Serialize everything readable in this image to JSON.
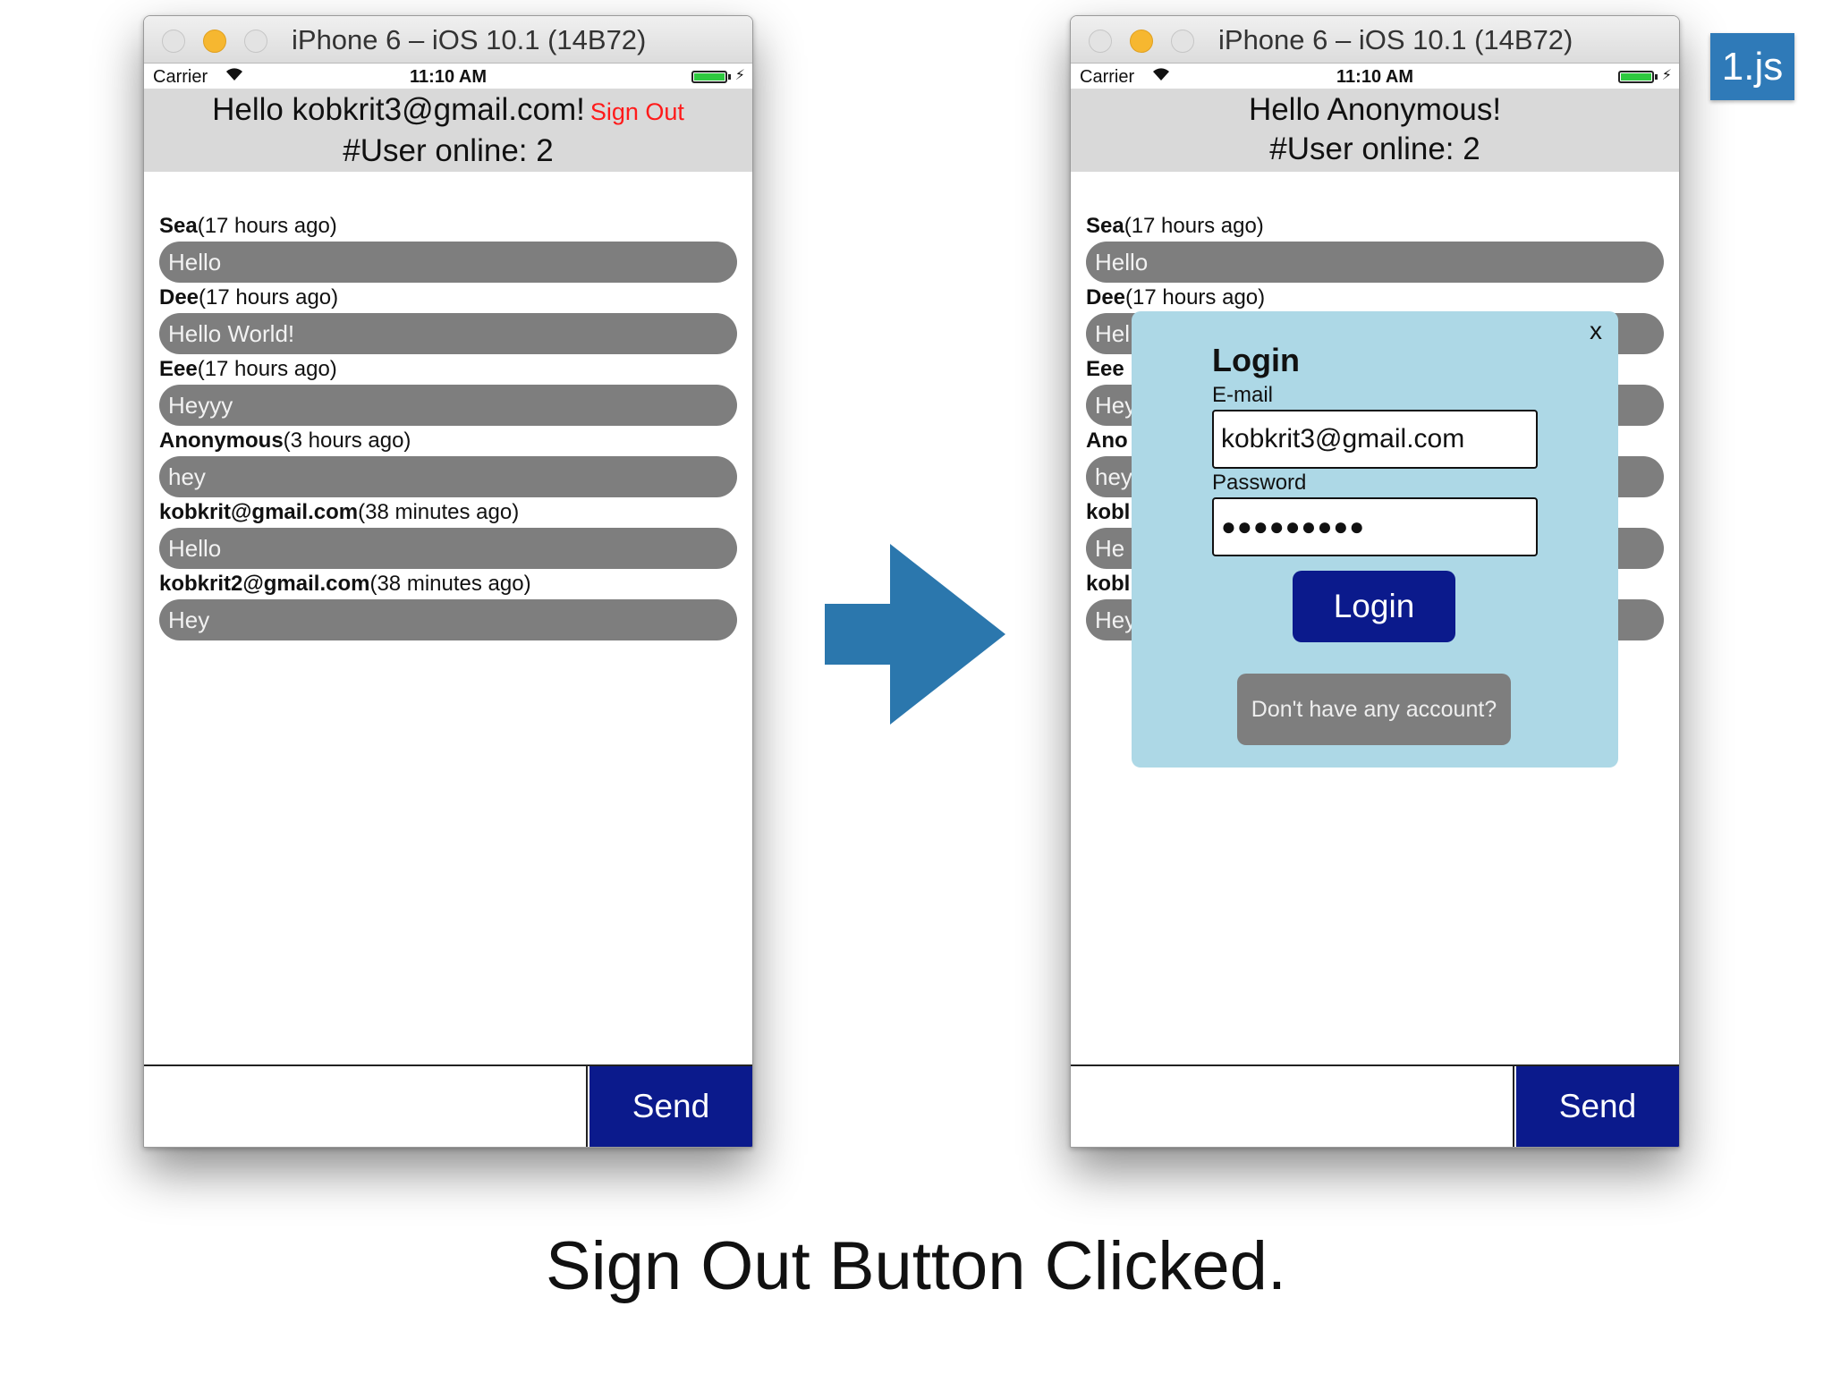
{
  "colors": {
    "accent": "#2f7ab8",
    "button_blue": "#0b1a8c",
    "bubble_gray": "#7e7e7e",
    "header_gray": "#d9d9d9",
    "modal_bg": "#add8e6",
    "signout_red": "#ff1a1a"
  },
  "badge": "1.js",
  "caption": "Sign Out Button Clicked.",
  "left": {
    "window_title": "iPhone 6 – iOS 10.1 (14B72)",
    "status": {
      "carrier": "Carrier",
      "time": "11:10 AM"
    },
    "greeting": "Hello kobkrit3@gmail.com!",
    "signout": "Sign Out",
    "online": "#User online: 2",
    "messages": [
      {
        "user": "Sea",
        "time": "(17 hours ago)",
        "text": "Hello"
      },
      {
        "user": "Dee",
        "time": "(17 hours ago)",
        "text": "Hello World!"
      },
      {
        "user": "Eee",
        "time": "(17 hours ago)",
        "text": "Heyyy"
      },
      {
        "user": "Anonymous",
        "time": "(3 hours ago)",
        "text": "hey"
      },
      {
        "user": "kobkrit@gmail.com",
        "time": "(38 minutes ago)",
        "text": " Hello"
      },
      {
        "user": "kobkrit2@gmail.com",
        "time": "(38 minutes ago)",
        "text": "Hey"
      }
    ],
    "send": "Send"
  },
  "right": {
    "window_title": "iPhone 6 – iOS 10.1 (14B72)",
    "status": {
      "carrier": "Carrier",
      "time": "11:10 AM"
    },
    "greeting": "Hello Anonymous!",
    "online": "#User online: 2",
    "messages": [
      {
        "user": "Sea",
        "time": "(17 hours ago)",
        "text": "Hello"
      },
      {
        "user": "Dee",
        "time": "(17 hours ago)",
        "text": "Hel"
      },
      {
        "user": "Eee",
        "time": "",
        "text": "Hey"
      },
      {
        "user": "Ano",
        "time": "",
        "text": "hey"
      },
      {
        "user": "kobl",
        "time": "",
        "text": " He"
      },
      {
        "user": "kobl",
        "time": "",
        "text": "Hey"
      }
    ],
    "send": "Send",
    "modal": {
      "close": "x",
      "title": "Login",
      "email_label": "E-mail",
      "email_value": "kobkrit3@gmail.com",
      "password_label": "Password",
      "password_value": "●●●●●●●●●",
      "login_button": "Login",
      "no_account": "Don't have any account?"
    }
  }
}
